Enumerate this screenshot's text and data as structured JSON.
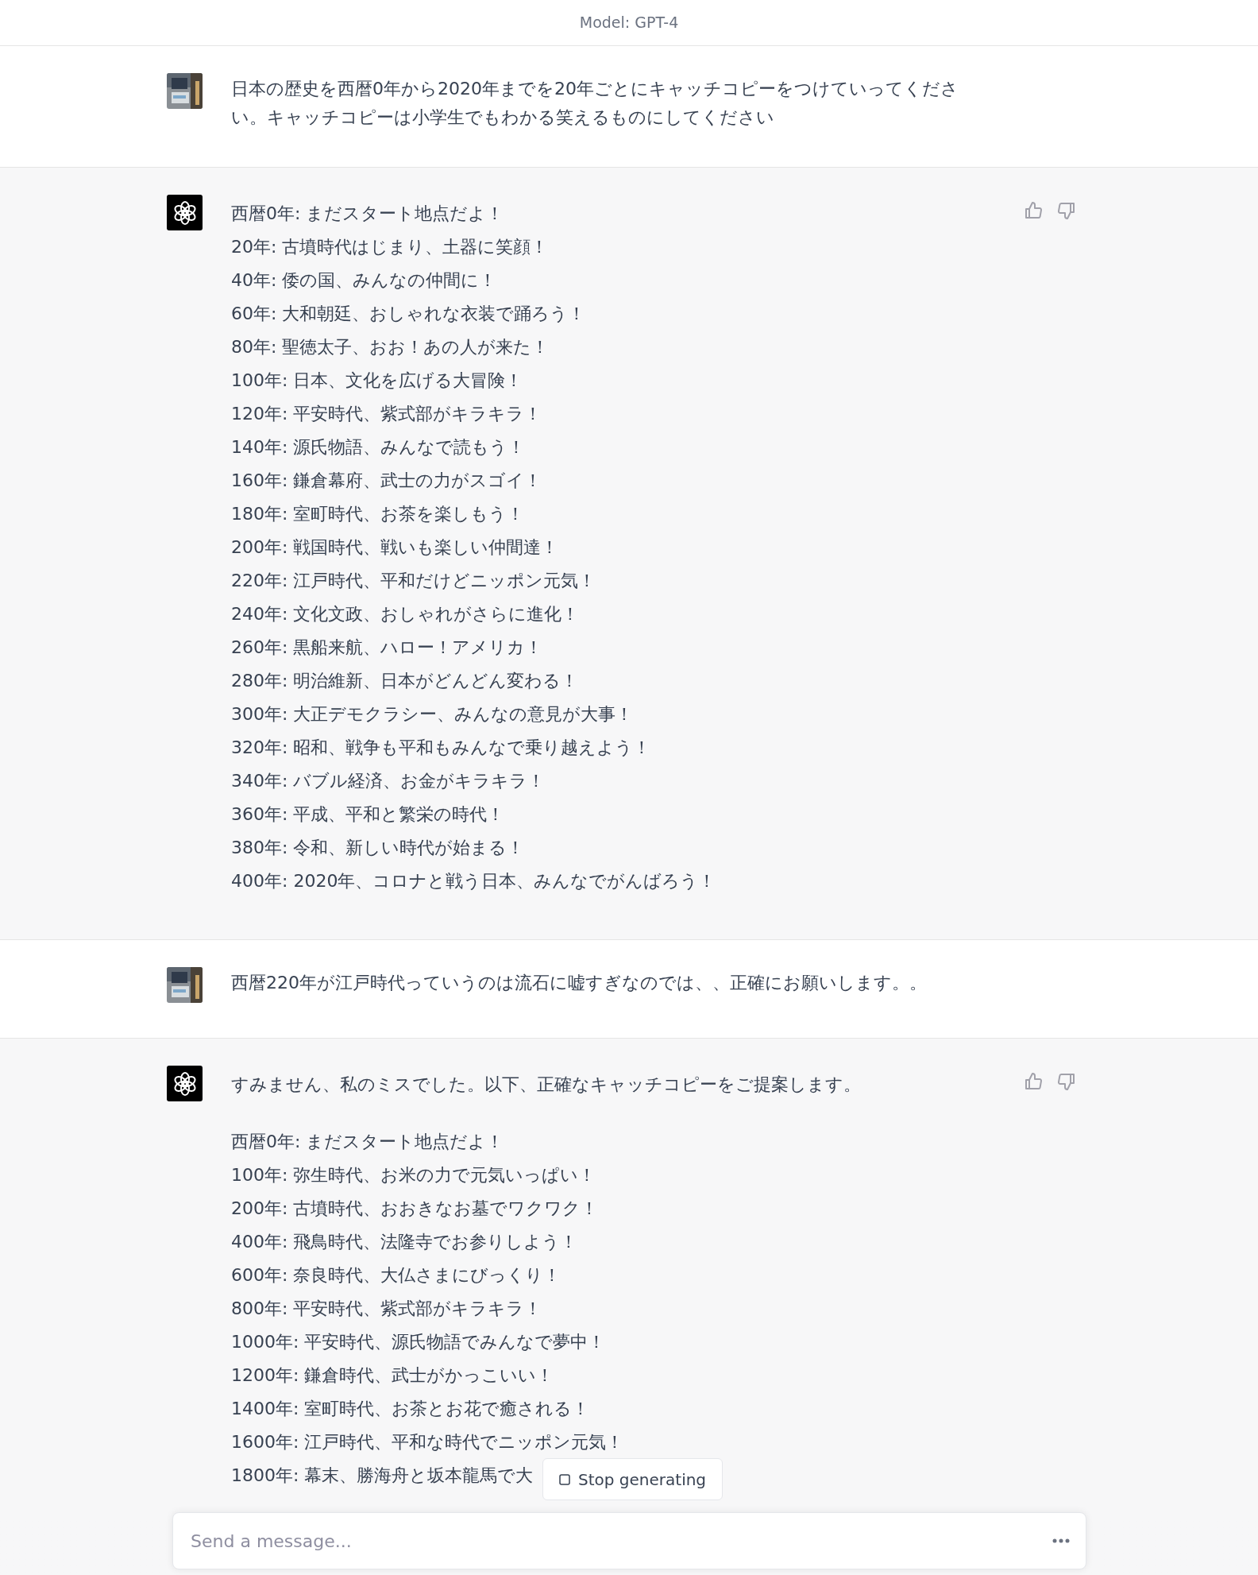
{
  "header": {
    "title": "Model: GPT-4"
  },
  "messages": [
    {
      "kind": "user",
      "text": "日本の歴史を西暦0年から2020年までを20年ごとにキャッチコピーをつけていってください。キャッチコピーは小学生でもわかる笑えるものにしてください"
    },
    {
      "kind": "assistant",
      "lines": [
        "西暦0年: まだスタート地点だよ！",
        "20年: 古墳時代はじまり、土器に笑顔！",
        "40年: 倭の国、みんなの仲間に！",
        "60年: 大和朝廷、おしゃれな衣装で踊ろう！",
        "80年: 聖徳太子、おお！あの人が来た！",
        "100年: 日本、文化を広げる大冒険！",
        "120年: 平安時代、紫式部がキラキラ！",
        "140年: 源氏物語、みんなで読もう！",
        "160年: 鎌倉幕府、武士の力がスゴイ！",
        "180年: 室町時代、お茶を楽しもう！",
        "200年: 戦国時代、戦いも楽しい仲間達！",
        "220年: 江戸時代、平和だけどニッポン元気！",
        "240年: 文化文政、おしゃれがさらに進化！",
        "260年: 黒船来航、ハロー！アメリカ！",
        "280年: 明治維新、日本がどんどん変わる！",
        "300年: 大正デモクラシー、みんなの意見が大事！",
        "320年: 昭和、戦争も平和もみんなで乗り越えよう！",
        "340年: バブル経済、お金がキラキラ！",
        "360年: 平成、平和と繁栄の時代！",
        "380年: 令和、新しい時代が始まる！",
        "400年: 2020年、コロナと戦う日本、みんなでがんばろう！"
      ]
    },
    {
      "kind": "user",
      "text": "西暦220年が江戸時代っていうのは流石に嘘すぎなのでは、、正確にお願いします。。"
    },
    {
      "kind": "assistant",
      "intro": "すみません、私のミスでした。以下、正確なキャッチコピーをご提案します。",
      "lines": [
        "西暦0年: まだスタート地点だよ！",
        "100年: 弥生時代、お米の力で元気いっぱい！",
        "200年: 古墳時代、おおきなお墓でワクワク！",
        "400年: 飛鳥時代、法隆寺でお参りしよう！",
        "600年: 奈良時代、大仏さまにびっくり！",
        "800年: 平安時代、紫式部がキラキラ！",
        "1000年: 平安時代、源氏物語でみんなで夢中！",
        "1200年: 鎌倉時代、武士がかっこいい！",
        "1400年: 室町時代、お茶とお花で癒される！",
        "1600年: 江戸時代、平和な時代でニッポン元気！",
        "1800年: 幕末、勝海舟と坂本龍馬で大"
      ]
    }
  ],
  "stop_button": {
    "label": "Stop generating"
  },
  "composer": {
    "placeholder": "Send a message..."
  }
}
